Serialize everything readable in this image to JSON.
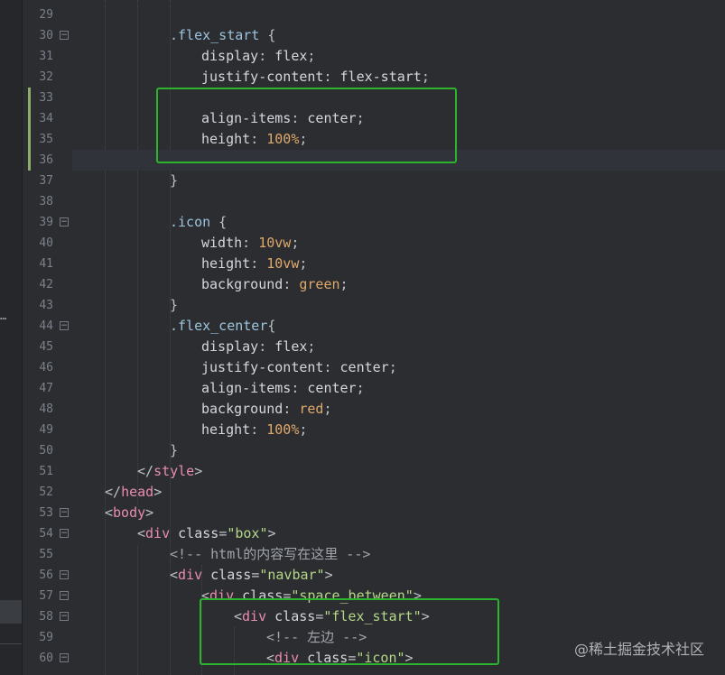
{
  "editor": {
    "lines": [
      {
        "n": "29",
        "fold": false,
        "tokens": []
      },
      {
        "n": "30",
        "fold": true,
        "tokens": [
          [
            "t-sel",
            ".flex_start"
          ],
          [
            "t-punct",
            " {"
          ]
        ]
      },
      {
        "n": "31",
        "fold": false,
        "tokens": [
          [
            "t-prop",
            "display"
          ],
          [
            "t-punct",
            ": "
          ],
          [
            "t-val",
            "flex"
          ],
          [
            "t-punct",
            ";"
          ]
        ]
      },
      {
        "n": "32",
        "fold": false,
        "tokens": [
          [
            "t-prop",
            "justify-content"
          ],
          [
            "t-punct",
            ": "
          ],
          [
            "t-val",
            "flex-start"
          ],
          [
            "t-punct",
            ";"
          ]
        ]
      },
      {
        "n": "33",
        "fold": false,
        "tokens": []
      },
      {
        "n": "34",
        "fold": false,
        "tokens": [
          [
            "t-prop",
            "align-items"
          ],
          [
            "t-punct",
            ": "
          ],
          [
            "t-val",
            "center"
          ],
          [
            "t-punct",
            ";"
          ]
        ]
      },
      {
        "n": "35",
        "fold": false,
        "tokens": [
          [
            "t-prop",
            "height"
          ],
          [
            "t-punct",
            ": "
          ],
          [
            "t-num",
            "100%"
          ],
          [
            "t-punct",
            ";"
          ]
        ]
      },
      {
        "n": "36",
        "fold": false,
        "tokens": []
      },
      {
        "n": "37",
        "fold": false,
        "tokens": [
          [
            "t-punct",
            "}"
          ]
        ]
      },
      {
        "n": "38",
        "fold": false,
        "tokens": []
      },
      {
        "n": "39",
        "fold": true,
        "tokens": [
          [
            "t-sel",
            ".icon"
          ],
          [
            "t-punct",
            " {"
          ]
        ]
      },
      {
        "n": "40",
        "fold": false,
        "tokens": [
          [
            "t-prop",
            "width"
          ],
          [
            "t-punct",
            ": "
          ],
          [
            "t-num",
            "10vw"
          ],
          [
            "t-punct",
            ";"
          ]
        ]
      },
      {
        "n": "41",
        "fold": false,
        "tokens": [
          [
            "t-prop",
            "height"
          ],
          [
            "t-punct",
            ": "
          ],
          [
            "t-num",
            "10vw"
          ],
          [
            "t-punct",
            ";"
          ]
        ]
      },
      {
        "n": "42",
        "fold": false,
        "tokens": [
          [
            "t-prop",
            "background"
          ],
          [
            "t-punct",
            ": "
          ],
          [
            "t-color",
            "green"
          ],
          [
            "t-punct",
            ";"
          ]
        ]
      },
      {
        "n": "43",
        "fold": false,
        "tokens": [
          [
            "t-punct",
            "}"
          ]
        ]
      },
      {
        "n": "44",
        "fold": true,
        "tokens": [
          [
            "t-sel",
            ".flex_center"
          ],
          [
            "t-punct",
            "{"
          ]
        ]
      },
      {
        "n": "45",
        "fold": false,
        "tokens": [
          [
            "t-prop",
            "display"
          ],
          [
            "t-punct",
            ": "
          ],
          [
            "t-val",
            "flex"
          ],
          [
            "t-punct",
            ";"
          ]
        ]
      },
      {
        "n": "46",
        "fold": false,
        "tokens": [
          [
            "t-prop",
            "justify-content"
          ],
          [
            "t-punct",
            ": "
          ],
          [
            "t-val",
            "center"
          ],
          [
            "t-punct",
            ";"
          ]
        ]
      },
      {
        "n": "47",
        "fold": false,
        "tokens": [
          [
            "t-prop",
            "align-items"
          ],
          [
            "t-punct",
            ": "
          ],
          [
            "t-val",
            "center"
          ],
          [
            "t-punct",
            ";"
          ]
        ]
      },
      {
        "n": "48",
        "fold": false,
        "tokens": [
          [
            "t-prop",
            "background"
          ],
          [
            "t-punct",
            ": "
          ],
          [
            "t-color",
            "red"
          ],
          [
            "t-punct",
            ";"
          ]
        ]
      },
      {
        "n": "49",
        "fold": false,
        "tokens": [
          [
            "t-prop",
            "height"
          ],
          [
            "t-punct",
            ": "
          ],
          [
            "t-num",
            "100%"
          ],
          [
            "t-punct",
            ";"
          ]
        ]
      },
      {
        "n": "50",
        "fold": false,
        "tokens": [
          [
            "t-punct",
            "}"
          ]
        ]
      },
      {
        "n": "51",
        "fold": false,
        "tokens": [
          [
            "t-punct",
            "</"
          ],
          [
            "t-tag",
            "style"
          ],
          [
            "t-punct",
            ">"
          ]
        ]
      },
      {
        "n": "52",
        "fold": false,
        "tokens": [
          [
            "t-punct",
            "</"
          ],
          [
            "t-tag",
            "head"
          ],
          [
            "t-punct",
            ">"
          ]
        ]
      },
      {
        "n": "53",
        "fold": true,
        "tokens": [
          [
            "t-punct",
            "<"
          ],
          [
            "t-tag",
            "body"
          ],
          [
            "t-punct",
            ">"
          ]
        ]
      },
      {
        "n": "54",
        "fold": true,
        "tokens": [
          [
            "t-punct",
            "<"
          ],
          [
            "t-tag",
            "div"
          ],
          [
            "t-attr",
            " class"
          ],
          [
            "t-punct",
            "="
          ],
          [
            "t-str",
            "\"box\""
          ],
          [
            "t-punct",
            ">"
          ]
        ]
      },
      {
        "n": "55",
        "fold": false,
        "tokens": [
          [
            "t-comment",
            "<!-- html的内容写在这里 -->"
          ]
        ]
      },
      {
        "n": "56",
        "fold": true,
        "tokens": [
          [
            "t-punct",
            "<"
          ],
          [
            "t-tag",
            "div"
          ],
          [
            "t-attr",
            " class"
          ],
          [
            "t-punct",
            "="
          ],
          [
            "t-str",
            "\"navbar\""
          ],
          [
            "t-punct",
            ">"
          ]
        ]
      },
      {
        "n": "57",
        "fold": true,
        "tokens": [
          [
            "t-punct",
            "<"
          ],
          [
            "t-tag",
            "div"
          ],
          [
            "t-attr",
            " class"
          ],
          [
            "t-punct",
            "="
          ],
          [
            "t-str",
            "\"space_between\""
          ],
          [
            "t-punct",
            ">"
          ]
        ]
      },
      {
        "n": "58",
        "fold": true,
        "tokens": [
          [
            "t-punct",
            "<"
          ],
          [
            "t-tag",
            "div"
          ],
          [
            "t-attr",
            " class"
          ],
          [
            "t-punct",
            "="
          ],
          [
            "t-str",
            "\"flex_start\""
          ],
          [
            "t-punct",
            ">"
          ]
        ]
      },
      {
        "n": "59",
        "fold": false,
        "tokens": [
          [
            "t-comment",
            "<!-- 左边 -->"
          ]
        ]
      },
      {
        "n": "60",
        "fold": true,
        "tokens": [
          [
            "t-punct",
            "<"
          ],
          [
            "t-tag",
            "div"
          ],
          [
            "t-attr",
            " class"
          ],
          [
            "t-punct",
            "="
          ],
          [
            "t-str",
            "\"icon\""
          ],
          [
            "t-punct",
            ">"
          ]
        ]
      }
    ],
    "colors": {
      "background": "#2b2d31",
      "highlight_box": "#2cb52c",
      "change_marker": "#8cae6a"
    }
  },
  "sidebar": {
    "overflow_text": "…"
  },
  "watermark": {
    "text": "@稀土掘金技术社区"
  }
}
